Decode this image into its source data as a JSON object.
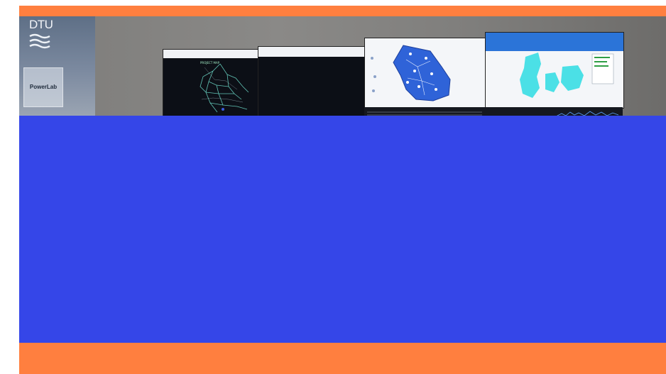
{
  "photo": {
    "logo_text": "DTU",
    "plate_text": "PowerLab",
    "map_label": "PROJECT MAP"
  },
  "colors": {
    "frame": "#ff7f3f",
    "content_block": "#3546e8",
    "map_blue": "#2f63d8",
    "map_cyan": "#4be0e6"
  }
}
